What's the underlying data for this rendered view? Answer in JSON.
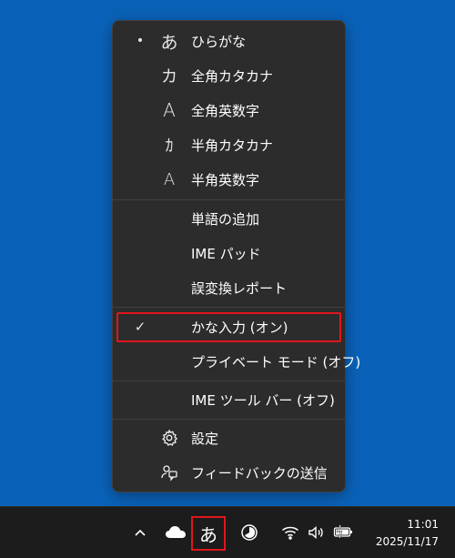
{
  "menu": {
    "items": [
      {
        "lead": "•",
        "glyph": "あ",
        "label": "ひらがな"
      },
      {
        "lead": "",
        "glyph": "カ",
        "label": "全角カタカナ"
      },
      {
        "lead": "",
        "glyph": "A",
        "label": "全角英数字"
      },
      {
        "lead": "",
        "glyph": "ｶ",
        "label": "半角カタカナ"
      },
      {
        "lead": "",
        "glyph": "A",
        "label": "半角英数字"
      },
      {
        "label": "単語の追加"
      },
      {
        "label": "IME パッド"
      },
      {
        "label": "誤変換レポート"
      },
      {
        "lead": "✓",
        "label": "かな入力 (オン)"
      },
      {
        "label": "プライベート モード (オフ)"
      },
      {
        "label": "IME ツール バー (オフ)"
      },
      {
        "icon": "gear-icon",
        "label": "設定"
      },
      {
        "icon": "feedback-icon",
        "label": "フィードバックの送信"
      }
    ]
  },
  "taskbar": {
    "chevron": "^",
    "ime_glyph": "あ",
    "time": "11:01",
    "date": "2025/11/17"
  },
  "colors": {
    "desktop": "#0a62b8",
    "menu_bg": "#2c2c2c",
    "highlight": "#e0161b",
    "taskbar": "#1c1c1c"
  }
}
